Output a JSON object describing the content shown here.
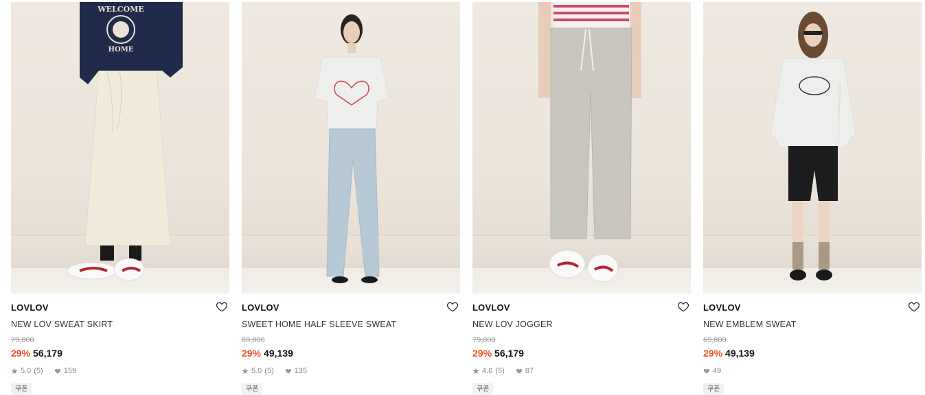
{
  "products": [
    {
      "brand": "LOVLOV",
      "name": "NEW LOV SWEAT SKIRT",
      "original_price": "79,800",
      "discount": "29%",
      "price": "56,179",
      "rating": "5.0",
      "reviews": "(5)",
      "likes": "159",
      "badge": "쿠폰",
      "image": "model-skirt-photo",
      "sweatshirt_text_top": "WELCOME",
      "sweatshirt_text_bottom": "HOME"
    },
    {
      "brand": "LOVLOV",
      "name": "SWEET HOME HALF SLEEVE SWEAT",
      "original_price": "69,800",
      "discount": "29%",
      "price": "49,139",
      "rating": "5.0",
      "reviews": "(5)",
      "likes": "135",
      "badge": "쿠폰",
      "image": "model-halfsleeve-photo"
    },
    {
      "brand": "LOVLOV",
      "name": "NEW LOV JOGGER",
      "original_price": "79,800",
      "discount": "29%",
      "price": "56,179",
      "rating": "4.6",
      "reviews": "(5)",
      "likes": "87",
      "badge": "쿠폰",
      "image": "model-jogger-photo"
    },
    {
      "brand": "LOVLOV",
      "name": "NEW EMBLEM SWEAT",
      "original_price": "69,800",
      "discount": "29%",
      "price": "49,139",
      "likes": "49",
      "badge": "쿠폰",
      "image": "model-emblem-photo"
    }
  ],
  "colors": {
    "discount": "#ef4e23",
    "price": "#111111",
    "muted": "#888888"
  }
}
